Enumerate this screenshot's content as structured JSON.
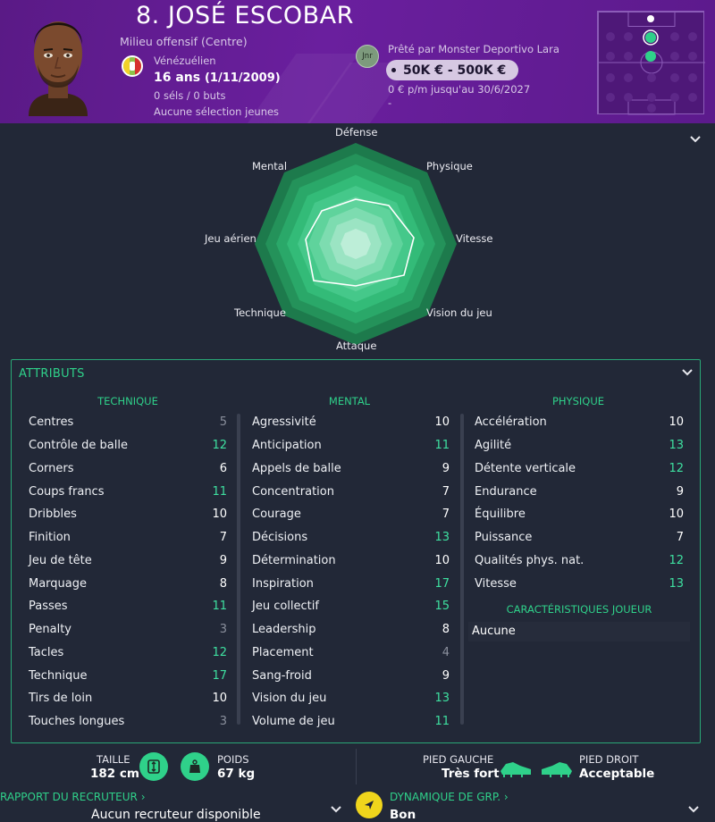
{
  "header": {
    "player_name": "8. JOSÉ ESCOBAR",
    "position": "Milieu offensif (Centre)",
    "nationality": "Vénézuélien",
    "age": "16 ans",
    "dob": "(1/11/2009)",
    "caps": "0 séls / 0 buts",
    "youth_caps": "Aucune sélection jeunes",
    "club_badge": "Jnr",
    "loan_text": "Prêté par Monster Deportivo Lara",
    "value": "50K € - 500K €",
    "wage": "0 € p/m jusqu'au 30/6/2027",
    "dash": "-"
  },
  "radar": {
    "labels": {
      "defense": "Défense",
      "physique": "Physique",
      "vitesse": "Vitesse",
      "vision": "Vision du jeu",
      "attaque": "Attaque",
      "technique": "Technique",
      "jeu_aerien": "Jeu aérien",
      "mental": "Mental"
    }
  },
  "attributes": {
    "title": "ATTRIBUTS",
    "technique": {
      "heading": "TECHNIQUE",
      "rows": [
        {
          "name": "Centres",
          "value": "5",
          "tone": "grey"
        },
        {
          "name": "Contrôle de balle",
          "value": "12",
          "tone": "green"
        },
        {
          "name": "Corners",
          "value": "6",
          "tone": "white"
        },
        {
          "name": "Coups francs",
          "value": "11",
          "tone": "green"
        },
        {
          "name": "Dribbles",
          "value": "10",
          "tone": "white"
        },
        {
          "name": "Finition",
          "value": "7",
          "tone": "white"
        },
        {
          "name": "Jeu de tête",
          "value": "9",
          "tone": "white"
        },
        {
          "name": "Marquage",
          "value": "8",
          "tone": "white"
        },
        {
          "name": "Passes",
          "value": "11",
          "tone": "green"
        },
        {
          "name": "Penalty",
          "value": "3",
          "tone": "grey"
        },
        {
          "name": "Tacles",
          "value": "12",
          "tone": "green"
        },
        {
          "name": "Technique",
          "value": "17",
          "tone": "green"
        },
        {
          "name": "Tirs de loin",
          "value": "10",
          "tone": "white"
        },
        {
          "name": "Touches longues",
          "value": "3",
          "tone": "grey"
        }
      ]
    },
    "mental": {
      "heading": "MENTAL",
      "rows": [
        {
          "name": "Agressivité",
          "value": "10",
          "tone": "white"
        },
        {
          "name": "Anticipation",
          "value": "11",
          "tone": "green"
        },
        {
          "name": "Appels de balle",
          "value": "9",
          "tone": "white"
        },
        {
          "name": "Concentration",
          "value": "7",
          "tone": "white"
        },
        {
          "name": "Courage",
          "value": "7",
          "tone": "white"
        },
        {
          "name": "Décisions",
          "value": "13",
          "tone": "green"
        },
        {
          "name": "Détermination",
          "value": "10",
          "tone": "white"
        },
        {
          "name": "Inspiration",
          "value": "17",
          "tone": "green"
        },
        {
          "name": "Jeu collectif",
          "value": "15",
          "tone": "green"
        },
        {
          "name": "Leadership",
          "value": "8",
          "tone": "white"
        },
        {
          "name": "Placement",
          "value": "4",
          "tone": "grey"
        },
        {
          "name": "Sang-froid",
          "value": "9",
          "tone": "white"
        },
        {
          "name": "Vision du jeu",
          "value": "13",
          "tone": "green"
        },
        {
          "name": "Volume de jeu",
          "value": "11",
          "tone": "green"
        }
      ]
    },
    "physique": {
      "heading": "PHYSIQUE",
      "rows": [
        {
          "name": "Accélération",
          "value": "10",
          "tone": "white"
        },
        {
          "name": "Agilité",
          "value": "13",
          "tone": "green"
        },
        {
          "name": "Détente verticale",
          "value": "12",
          "tone": "green"
        },
        {
          "name": "Endurance",
          "value": "9",
          "tone": "white"
        },
        {
          "name": "Équilibre",
          "value": "10",
          "tone": "white"
        },
        {
          "name": "Puissance",
          "value": "7",
          "tone": "white"
        },
        {
          "name": "Qualités phys. nat.",
          "value": "12",
          "tone": "green"
        },
        {
          "name": "Vitesse",
          "value": "13",
          "tone": "green"
        }
      ]
    },
    "traits_heading": "CARACTÉRISTIQUES JOUEUR",
    "traits_value": "Aucune"
  },
  "footer": {
    "height_label": "TAILLE",
    "height_value": "182 cm",
    "weight_label": "POIDS",
    "weight_value": "67 kg",
    "left_foot_label": "PIED GAUCHE",
    "left_foot_value": "Très fort",
    "right_foot_label": "PIED DROIT",
    "right_foot_value": "Acceptable",
    "scout_link": "RAPPORT DU RECRUTEUR ›",
    "scout_value": "Aucun recruteur disponible",
    "dynamics_link": "DYNAMIQUE DE GRP. ›",
    "dynamics_value": "Bon"
  },
  "colors": {
    "header_purple": "#6a1f9e",
    "accent_green": "#2fd18a",
    "background": "#222837"
  }
}
